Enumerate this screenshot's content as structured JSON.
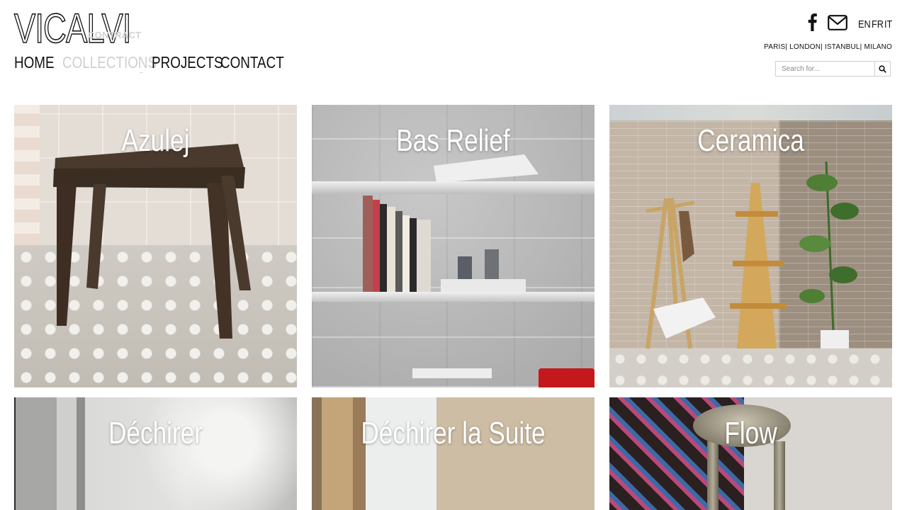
{
  "header": {
    "logo_text": "VICALVI",
    "logo_sub": "CONTRACT",
    "languages": [
      "EN",
      "FR",
      "IT"
    ],
    "cities": "PARIS| LONDON| ISTANBUL| MILANO",
    "icons": {
      "facebook": "facebook-icon",
      "mail": "mail-icon",
      "search": "search-icon"
    }
  },
  "nav": {
    "items": [
      "HOME",
      "COLLECTIONS",
      "PROJECTS",
      "CONTACT"
    ],
    "collections_caret": "-"
  },
  "search": {
    "placeholder": "Search for..."
  },
  "collections": [
    {
      "title": "Azulej"
    },
    {
      "title": "Bas Relief"
    },
    {
      "title": "Ceramica"
    },
    {
      "title": "Déchirer"
    },
    {
      "title": "Déchirer la Suite"
    },
    {
      "title": "Flow"
    }
  ],
  "colors": {
    "accent_muted": "#cfcfcf",
    "text": "#111111",
    "tile_title": "#ffffff"
  }
}
